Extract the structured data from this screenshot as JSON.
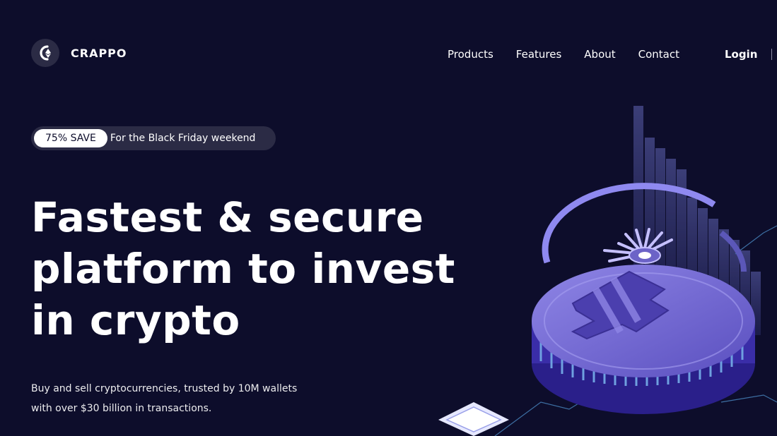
{
  "brand": {
    "name": "CRAPPO",
    "logo_icon": "crappo-logo-icon"
  },
  "nav": {
    "items": [
      {
        "label": "Products"
      },
      {
        "label": "Features"
      },
      {
        "label": "About"
      },
      {
        "label": "Contact"
      }
    ],
    "login_label": "Login"
  },
  "promo": {
    "badge": "75% SAVE",
    "text": "For the Black Friday weekend"
  },
  "hero": {
    "headline_lines": [
      "Fastest & secure",
      "platform to invest",
      "in crypto"
    ],
    "subtext_lines": [
      "Buy and sell cryptocurrencies, trusted by 10M wallets",
      "with over $30 billion in transactions."
    ]
  },
  "illustration": {
    "icon": "bitcoin-coin-illustration"
  },
  "colors": {
    "background": "#0d0d2b",
    "pill_bg": "#2b2b45",
    "accent": "#6c63c7",
    "accent_light": "#a8a2ff"
  }
}
